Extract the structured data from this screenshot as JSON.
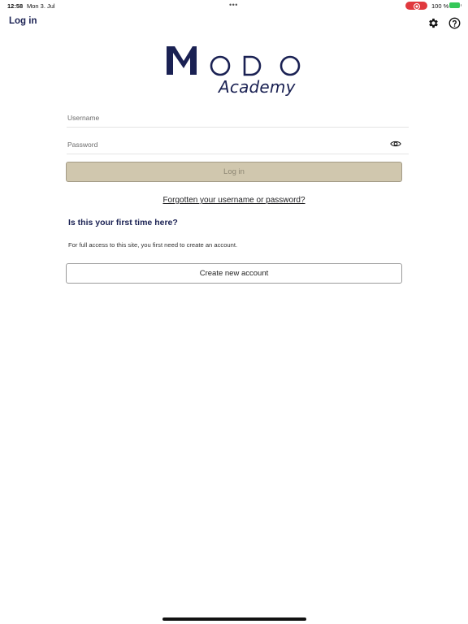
{
  "status_bar": {
    "time": "12:58",
    "date": "Mon 3. Jul",
    "dots": "•••",
    "battery_percent": "100 %",
    "battery_level": 1.0,
    "recording_color": "#e0393e",
    "battery_color": "#35c759"
  },
  "header": {
    "title": "Log in",
    "settings_icon": "gear-icon",
    "help_icon": "question-circle-icon"
  },
  "logo": {
    "wordmark": "MODO",
    "subtitle": "Academy",
    "color": "#1a2153"
  },
  "form": {
    "username_placeholder": "Username",
    "username_value": "",
    "password_placeholder": "Password",
    "password_value": "",
    "show_password_icon": "eye-icon",
    "login_label": "Log in",
    "login_color": "#d0c7ae",
    "forgot_link": "Forgotten your username or password?"
  },
  "signup": {
    "heading": "Is this your first time here?",
    "description": "For full access to this site, you first need to create an account.",
    "create_label": "Create new account"
  }
}
